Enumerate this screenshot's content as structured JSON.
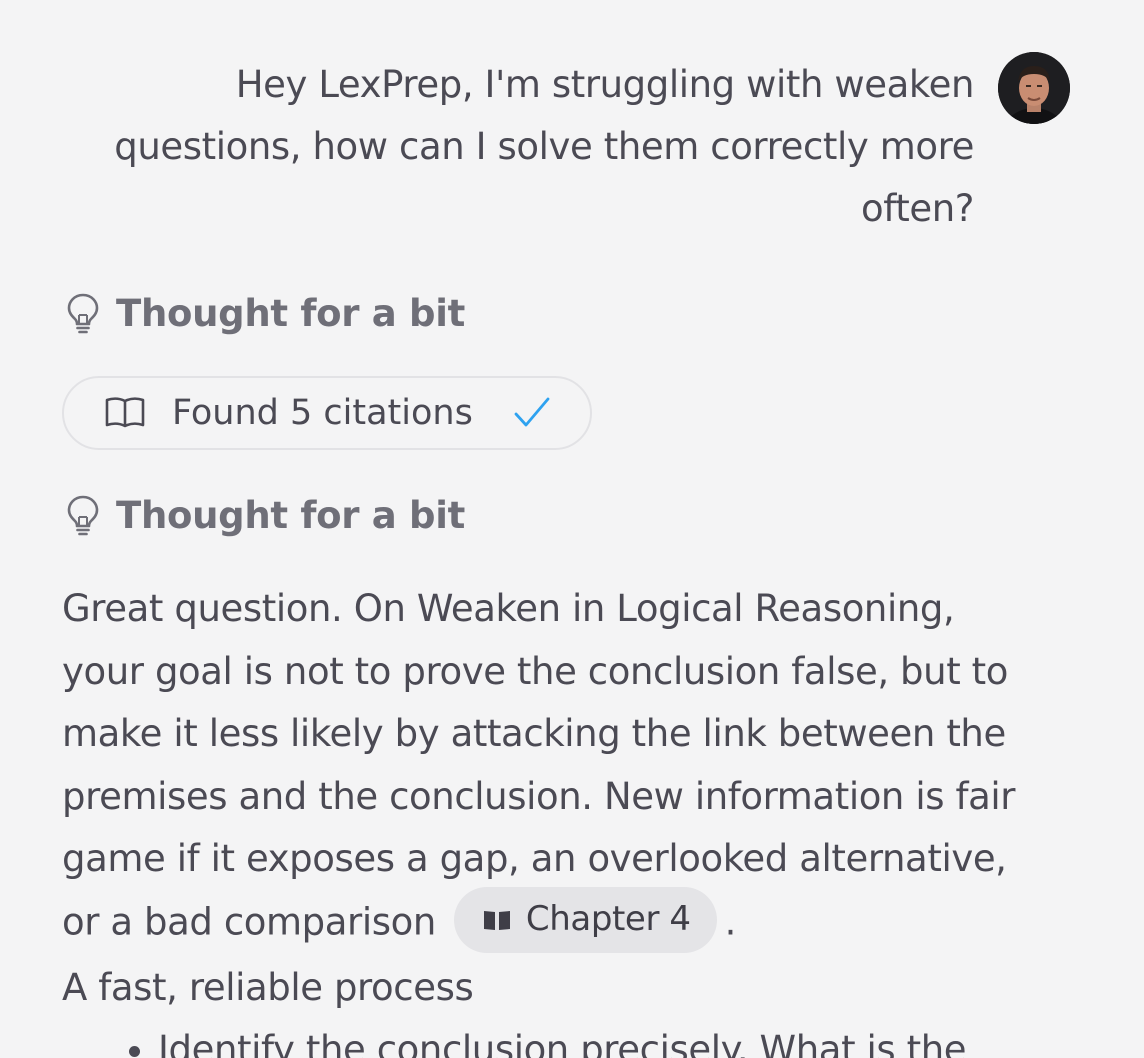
{
  "user_message": {
    "line1": "Hey LexPrep, I'm struggling with weaken",
    "line2": "questions, how can I solve them correctly more",
    "line3": "often?"
  },
  "thought_1": {
    "label": "Thought for a bit",
    "icon": "lightbulb-icon"
  },
  "citations": {
    "label": "Found 5 citations",
    "icon": "book-icon",
    "status_icon": "checkmark-icon",
    "check_color": "#2ea2f0"
  },
  "thought_2": {
    "label": "Thought for a bit",
    "icon": "lightbulb-icon"
  },
  "answer": {
    "line1": "Great question. On Weaken in Logical Reasoning,",
    "line2": "your goal is not to prove the conclusion false, but to",
    "line3": "make it less likely by attacking the link between the",
    "line4": "premises and the conclusion. New information is fair",
    "line5": "game if it exposes a gap, an overlooked alternative,",
    "line6_text": "or a bad comparison",
    "chapter_chip": "Chapter 4",
    "line6_end": ".",
    "process_heading": "A fast, reliable process",
    "bullet_1": "Identify the conclusion precisely. What is the"
  }
}
